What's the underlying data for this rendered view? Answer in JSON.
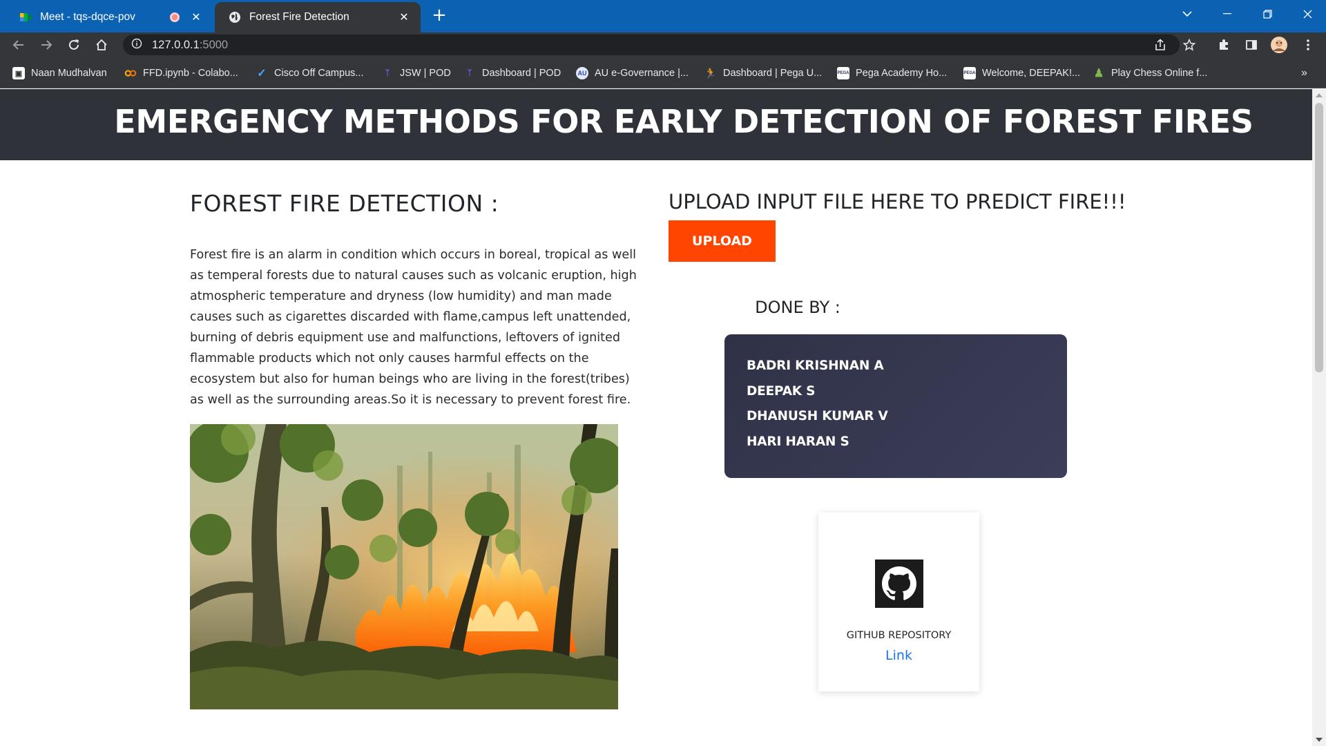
{
  "browser": {
    "tabs": [
      {
        "title": "Meet - tqs-dqce-pov",
        "active": false,
        "recording": true
      },
      {
        "title": "Forest Fire Detection",
        "active": true,
        "recording": false
      }
    ],
    "url_host": "127.0.0.1",
    "url_port": ":5000",
    "bookmarks": [
      {
        "label": "Naan Mudhalvan",
        "icon": "naan-mudhalvan-icon"
      },
      {
        "label": "FFD.ipynb - Colabo...",
        "icon": "colab-icon"
      },
      {
        "label": "Cisco Off Campus...",
        "icon": "check-icon"
      },
      {
        "label": "JSW | POD",
        "icon": "pod-icon"
      },
      {
        "label": "Dashboard | POD",
        "icon": "pod-icon"
      },
      {
        "label": "AU e-Governance |...",
        "icon": "au-icon"
      },
      {
        "label": "Dashboard | Pega U...",
        "icon": "pega-runner-icon"
      },
      {
        "label": "Pega Academy Ho...",
        "icon": "pega-icon"
      },
      {
        "label": "Welcome, DEEPAK!...",
        "icon": "pega-icon"
      },
      {
        "label": "Play Chess Online f...",
        "icon": "chess-icon"
      }
    ],
    "colors": {
      "tabbar": "#0b62b3",
      "toolbar": "#34363a"
    }
  },
  "page": {
    "header_title": "EMERGENCY METHODS FOR EARLY DETECTION OF FOREST FIRES",
    "section_title": "FOREST FIRE DETECTION :",
    "description": "Forest fire is an alarm in condition which occurs in boreal, tropical as well as temperal forests due to natural causes such as volcanic eruption, high atmospheric temperature and dryness (low humidity) and man made causes such as cigarettes discarded with flame,campus left unattended, burning of debris equipment use and malfunctions, leftovers of ignited flammable products which not only causes harmful effects on the ecosystem but also for human beings who are living in the forest(tribes) as well as the surrounding areas.So it is necessary to prevent forest fire.",
    "upload_title": "UPLOAD INPUT FILE HERE TO PREDICT FIRE!!!",
    "upload_button": "UPLOAD",
    "done_by_title": "DONE BY :",
    "team": [
      "BADRI KRISHNAN A",
      "DEEPAK S",
      "DHANUSH KUMAR V",
      "HARI HARAN S"
    ],
    "github_label": "GITHUB REPOSITORY",
    "github_link": "Link",
    "colors": {
      "header_bg": "#2f3238",
      "upload_button": "#ff4500",
      "card_bg": "#34364f",
      "link": "#1a73e8"
    }
  }
}
